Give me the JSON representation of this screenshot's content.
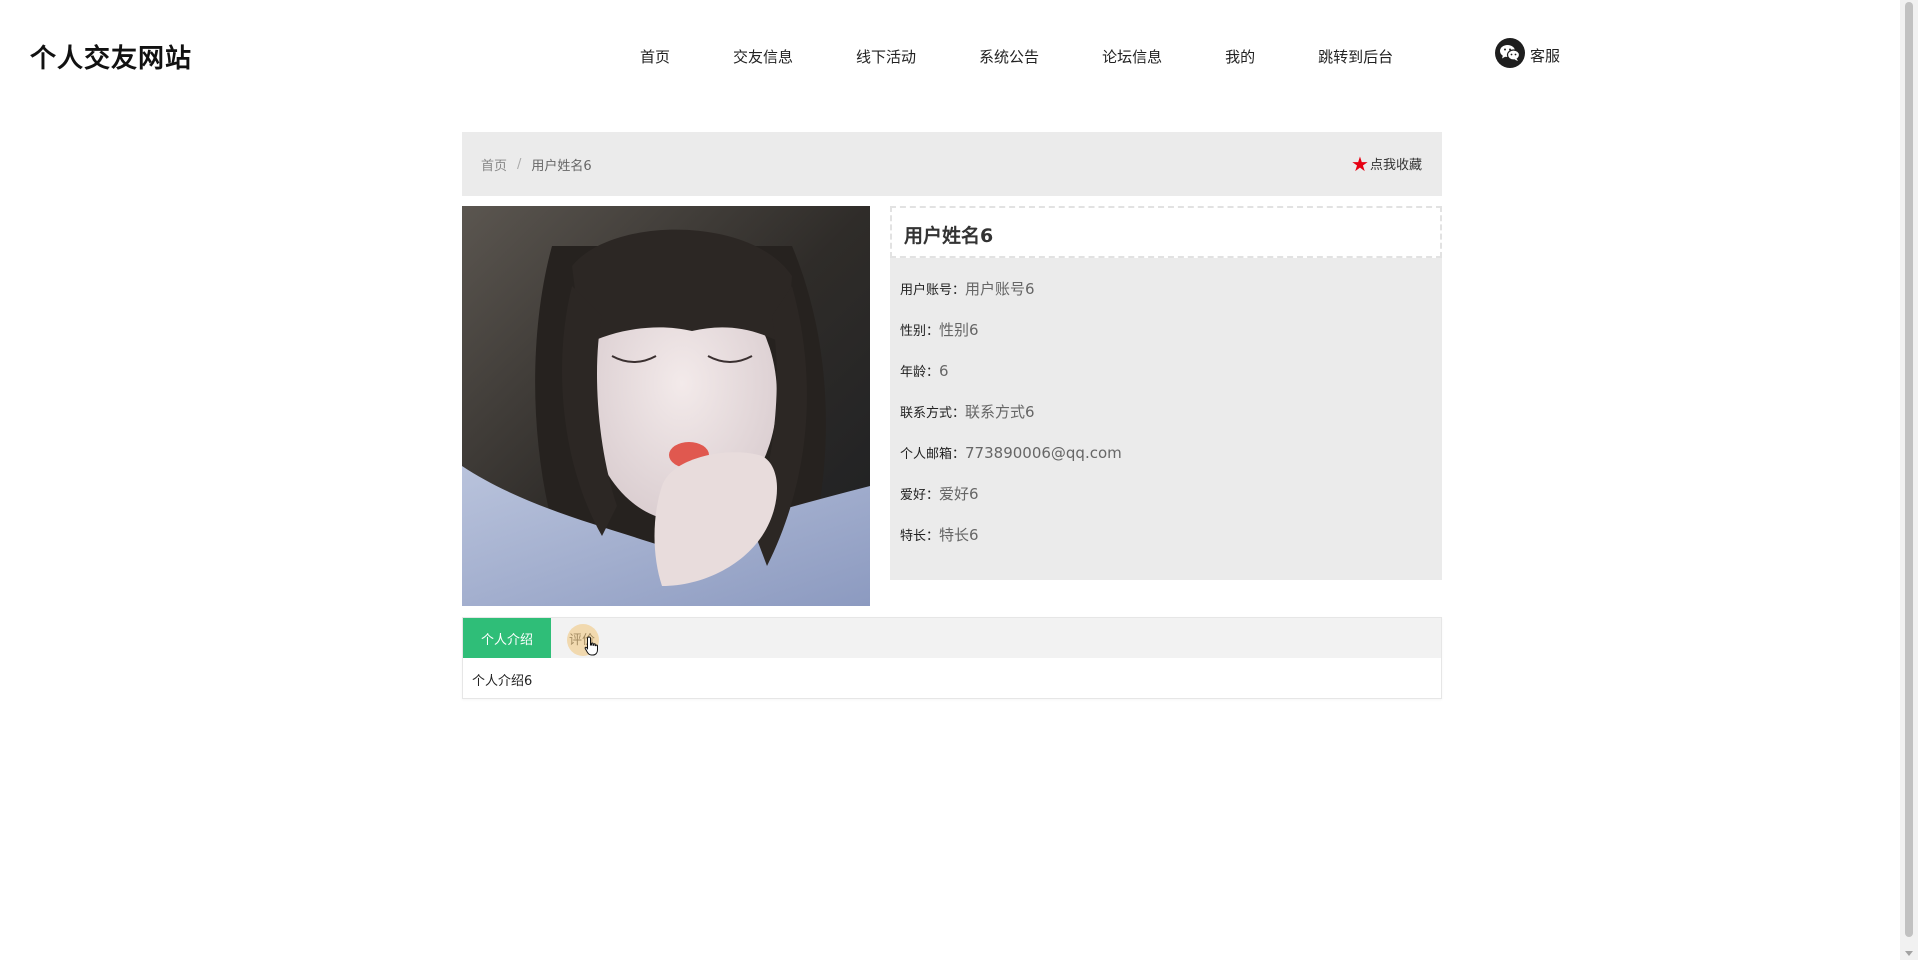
{
  "site": {
    "title": "个人交友网站"
  },
  "nav": {
    "items": [
      "首页",
      "交友信息",
      "线下活动",
      "系统公告",
      "论坛信息",
      "我的",
      "跳转到后台"
    ],
    "service_label": "客服",
    "service_icon": "wechat-icon"
  },
  "breadcrumb": {
    "home": "首页",
    "separator": "/",
    "current": "用户姓名6"
  },
  "favorite": {
    "label": "点我收藏",
    "icon": "star-icon",
    "color": "#e60012"
  },
  "profile": {
    "name": "用户姓名6",
    "fields": [
      {
        "key": "用户账号：",
        "value": "用户账号6"
      },
      {
        "key": "性别：",
        "value": "性别6"
      },
      {
        "key": "年龄：",
        "value": "6"
      },
      {
        "key": "联系方式：",
        "value": "联系方式6"
      },
      {
        "key": "个人邮箱：",
        "value": "773890006@qq.com"
      },
      {
        "key": "爱好：",
        "value": "爱好6"
      },
      {
        "key": "特长：",
        "value": "特长6"
      }
    ]
  },
  "tabs": {
    "items": [
      "个人介绍",
      "评价"
    ],
    "active_index": 0,
    "active_color": "#2fbe78",
    "content": "个人介绍6"
  }
}
